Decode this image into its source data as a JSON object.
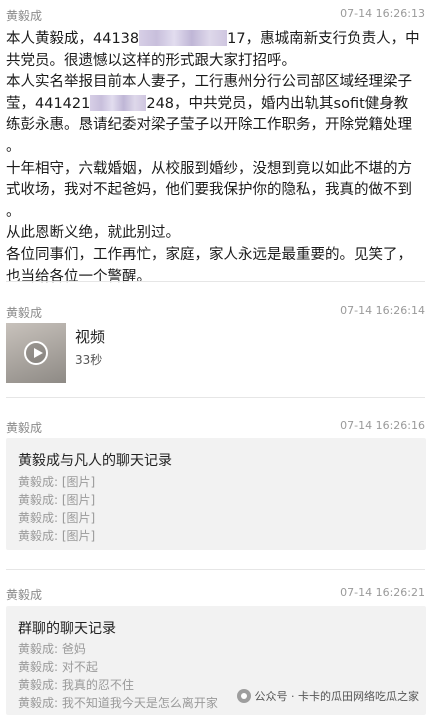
{
  "messages": [
    {
      "sender": "黄毅成",
      "time": "07-14 16:26:13",
      "paragraphs": [
        {
          "line1_a": "本人黄毅成，44138",
          "line1_b": "17，惠城南新支行负责人，中",
          "line2": "共党员。很遗憾以这样的形式跟大家打招呼。"
        },
        {
          "line1": "本人实名举报目前本人妻子，工行惠州分行公司部区域经理梁子",
          "line2_a": "莹，441421",
          "line2_b": "248，中共党员，婚内出轨其sofit健身教",
          "line3": "练彭永惠。恳请纪委对梁子莹子以开除工作职务，开除党籍处理",
          "line4": "。"
        },
        {
          "line1": "十年相守，六载婚姻，从校服到婚纱，没想到竟以如此不堪的方",
          "line2": "式收场，我对不起爸妈，他们要我保护你的隐私，我真的做不到",
          "line3": "。"
        },
        {
          "line1": "从此恩断义绝，就此别过。",
          "line2": "各位同事们，工作再忙，家庭，家人永远是最重要的。见笑了，",
          "line3": "也当给各位一个警醒。"
        }
      ]
    },
    {
      "sender": "黄毅成",
      "time": "07-14 16:26:14",
      "video_title": "视频",
      "video_duration": "33秒"
    },
    {
      "sender": "黄毅成",
      "time": "07-14 16:26:16",
      "record_title": "黄毅成与凡人的聊天记录",
      "record_lines": [
        "黄毅成: [图片]",
        "黄毅成: [图片]",
        "黄毅成: [图片]",
        "黄毅成: [图片]"
      ]
    },
    {
      "sender": "黄毅成",
      "time": "07-14 16:26:21",
      "record_title": "群聊的聊天记录",
      "record_lines": [
        "黄毅成: 爸妈",
        "黄毅成: 对不起",
        "黄毅成: 我真的忍不住",
        "黄毅成: 我不知道我今天是怎么离开家"
      ]
    }
  ],
  "watermark": "公众号 · 卡卡的瓜田网络吃瓜之家",
  "icons": {
    "video_play": "play-icon",
    "watermark": "wechat-official-account-icon"
  }
}
